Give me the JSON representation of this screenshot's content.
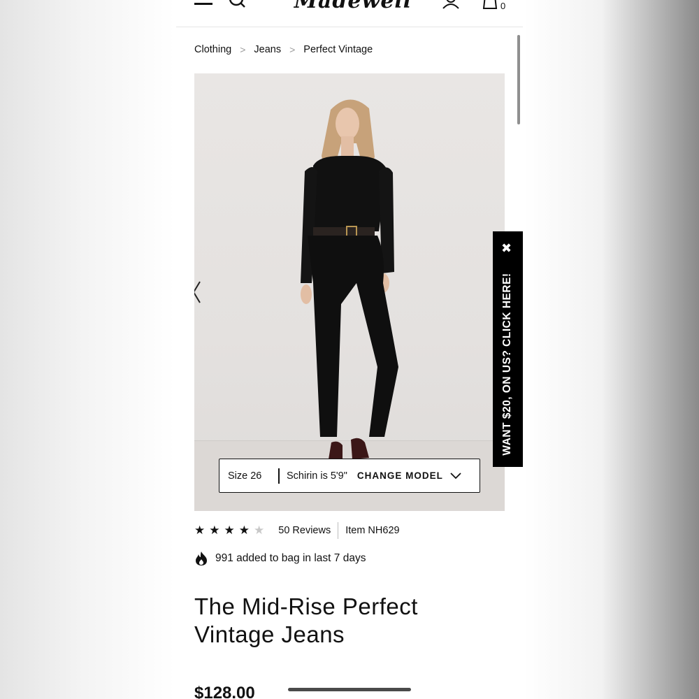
{
  "header": {
    "logo_text": "Madewell",
    "bag_count": "0",
    "icons": [
      "menu-icon",
      "search-icon",
      "account-icon",
      "shopping-bag-icon"
    ]
  },
  "breadcrumb": {
    "items": [
      "Clothing",
      "Jeans",
      "Perfect Vintage"
    ],
    "separator": ">"
  },
  "gallery": {
    "model": {
      "size_label": "Size 26",
      "info": "Schirin is 5'9\"",
      "change_label": "CHANGE MODEL"
    }
  },
  "promo": {
    "close": "✖",
    "text": "WANT $20, ON US? CLICK HERE!"
  },
  "rating": {
    "value": 4,
    "max": 5,
    "reviews": "50 Reviews",
    "item": "Item NH629"
  },
  "popularity": {
    "text": "991 added to bag in last 7 days"
  },
  "product": {
    "title": "The Mid-Rise Perfect Vintage Jeans",
    "price": "$128.00"
  },
  "colors": {
    "text": "#111111",
    "promo_bg": "#000000",
    "star_empty": "#c8c8c8"
  }
}
